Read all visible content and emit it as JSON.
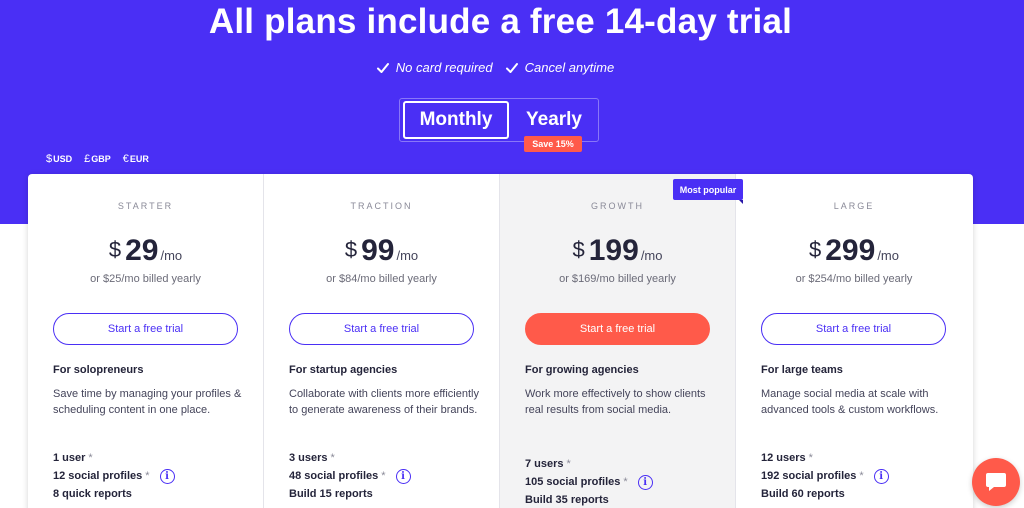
{
  "hero": {
    "title": "All plans include a free 14-day trial",
    "perks": [
      "No card required",
      "Cancel anytime"
    ]
  },
  "billing_toggle": {
    "monthly_label": "Monthly",
    "yearly_label": "Yearly",
    "selected": "Monthly",
    "save_badge": "Save 15%"
  },
  "currencies": [
    {
      "symbol": "$",
      "code": "USD"
    },
    {
      "symbol": "£",
      "code": "GBP"
    },
    {
      "symbol": "€",
      "code": "EUR"
    }
  ],
  "most_popular_label": "Most popular",
  "plans": [
    {
      "name": "STARTER",
      "currency": "$",
      "price": "29",
      "period": "/mo",
      "billed_prefix": "or $",
      "billed_amount": "25",
      "billed_suffix": "/mo billed yearly",
      "cta": "Start a free trial",
      "audience": "For solopreneurs",
      "description": "Save time by managing your profiles & scheduling content in one place.",
      "features": [
        {
          "text": "1 user",
          "star": "*"
        },
        {
          "text": "12 social profiles",
          "star": "*",
          "info": true
        },
        {
          "text": "8 quick reports"
        }
      ]
    },
    {
      "name": "TRACTION",
      "currency": "$",
      "price": "99",
      "period": "/mo",
      "billed_prefix": "or $",
      "billed_amount": "84",
      "billed_suffix": "/mo billed yearly",
      "cta": "Start a free trial",
      "audience": "For startup agencies",
      "description": "Collaborate with clients more efficiently to generate awareness of their brands.",
      "features": [
        {
          "text": "3 users",
          "star": "*"
        },
        {
          "text": "48 social profiles",
          "star": "*",
          "info": true
        },
        {
          "text": "Build 15 reports"
        }
      ]
    },
    {
      "name": "GROWTH",
      "currency": "$",
      "price": "199",
      "period": "/mo",
      "billed_prefix": "or $",
      "billed_amount": "169",
      "billed_suffix": "/mo billed yearly",
      "cta": "Start a free trial",
      "audience": "For growing agencies",
      "description": "Work more effectively to show clients real results from social media.",
      "features": [
        {
          "text": "7 users",
          "star": "*"
        },
        {
          "text": "105 social profiles",
          "star": "*",
          "info": true
        },
        {
          "text": "Build 35 reports"
        }
      ]
    },
    {
      "name": "LARGE",
      "currency": "$",
      "price": "299",
      "period": "/mo",
      "billed_prefix": "or $",
      "billed_amount": "254",
      "billed_suffix": "/mo billed yearly",
      "cta": "Start a free trial",
      "audience": "For large teams",
      "description": "Manage social media at scale with advanced tools & custom workflows.",
      "features": [
        {
          "text": "12 users",
          "star": "*"
        },
        {
          "text": "192 social profiles",
          "star": "*",
          "info": true
        },
        {
          "text": "Build 60 reports"
        }
      ]
    }
  ],
  "colors": {
    "brand": "#4a2ff5",
    "accent": "#ff5a4a"
  }
}
